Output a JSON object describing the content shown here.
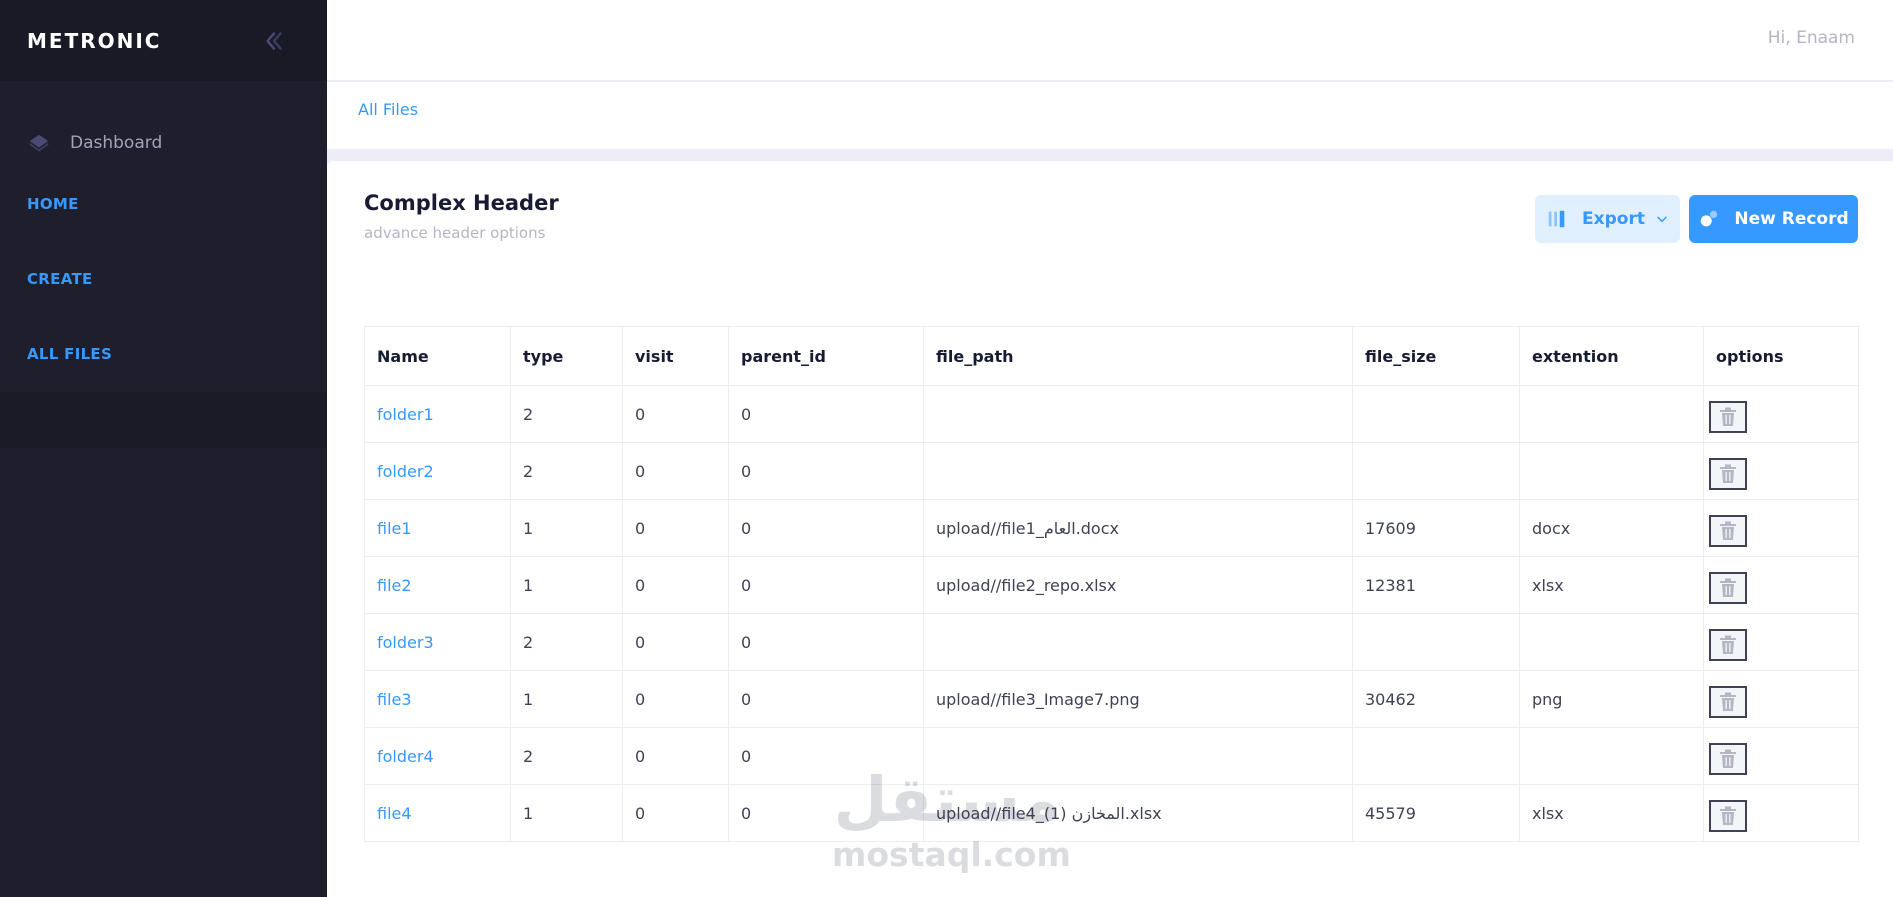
{
  "sidebar": {
    "brand": "METRONIC",
    "dashboard_label": "Dashboard",
    "links": [
      "HOME",
      "CREATE",
      "ALL FILES"
    ]
  },
  "header": {
    "greeting": "Hi, Enaam"
  },
  "breadcrumb": "All Files",
  "card": {
    "title": "Complex Header",
    "subtitle": "advance header options",
    "export_label": "Export",
    "new_record_label": "New Record"
  },
  "table": {
    "headers": [
      "Name",
      "type",
      "visit",
      "parent_id",
      "file_path",
      "file_size",
      "extention",
      "options"
    ],
    "rows": [
      {
        "name": "folder1",
        "type": "2",
        "visit": "0",
        "parent_id": "0",
        "file_path": "",
        "file_size": "",
        "extention": ""
      },
      {
        "name": "folder2",
        "type": "2",
        "visit": "0",
        "parent_id": "0",
        "file_path": "",
        "file_size": "",
        "extention": ""
      },
      {
        "name": "file1",
        "type": "1",
        "visit": "0",
        "parent_id": "0",
        "file_path": "upload//file1_العام.docx",
        "file_size": "17609",
        "extention": "docx"
      },
      {
        "name": "file2",
        "type": "1",
        "visit": "0",
        "parent_id": "0",
        "file_path": "upload//file2_repo.xlsx",
        "file_size": "12381",
        "extention": "xlsx"
      },
      {
        "name": "folder3",
        "type": "2",
        "visit": "0",
        "parent_id": "0",
        "file_path": "",
        "file_size": "",
        "extention": ""
      },
      {
        "name": "file3",
        "type": "1",
        "visit": "0",
        "parent_id": "0",
        "file_path": "upload//file3_Image7.png",
        "file_size": "30462",
        "extention": "png"
      },
      {
        "name": "folder4",
        "type": "2",
        "visit": "0",
        "parent_id": "0",
        "file_path": "",
        "file_size": "",
        "extention": ""
      },
      {
        "name": "file4",
        "type": "1",
        "visit": "0",
        "parent_id": "0",
        "file_path": "upload//file4_المخازن (1).xlsx",
        "file_size": "45579",
        "extention": "xlsx"
      }
    ]
  },
  "watermark": {
    "arabic": "مستقل",
    "latin": "mostaql.com"
  },
  "colors": {
    "accent": "#3699ff",
    "sidebar_bg": "#1e1e2d",
    "brand_bg": "#1a1a27"
  }
}
